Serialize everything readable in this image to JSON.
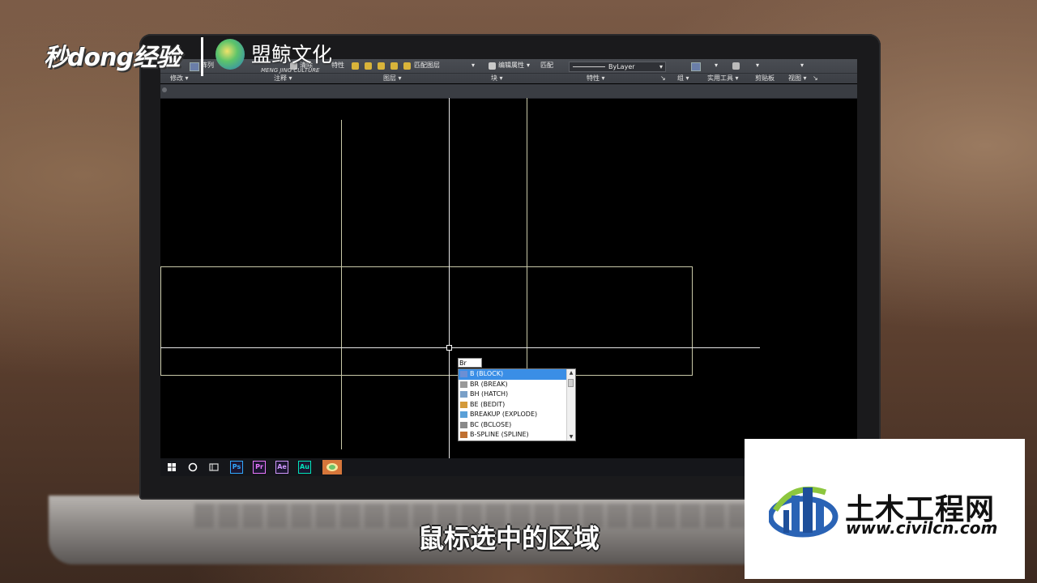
{
  "ribbon": {
    "row1": {
      "array_label": "阵列",
      "clear_label": "清除",
      "properties_label": "特性",
      "match_layer_label": "匹配图层",
      "edit_attr_label": "编辑属性",
      "match_label": "匹配",
      "bylayer_value": "ByLayer"
    },
    "panels": {
      "modify": "修改",
      "annotate": "注释",
      "layers": "图层",
      "block": "块",
      "properties": "特性",
      "group": "组",
      "utilities": "实用工具",
      "clipboard": "剪贴板",
      "view": "视图"
    }
  },
  "command": {
    "input_value": "Br",
    "suggestions": [
      {
        "label": "B (BLOCK)",
        "icon": "block-icon",
        "selected": true
      },
      {
        "label": "BR (BREAK)",
        "icon": "break-icon",
        "selected": false
      },
      {
        "label": "BH (HATCH)",
        "icon": "hatch-icon",
        "selected": false
      },
      {
        "label": "BE (BEDIT)",
        "icon": "bedit-icon",
        "selected": false
      },
      {
        "label": "BREAKUP (EXPLODE)",
        "icon": "explode-icon",
        "selected": false
      },
      {
        "label": "BC (BCLOSE)",
        "icon": "bclose-icon",
        "selected": false
      },
      {
        "label": "B-SPLINE (SPLINE)",
        "icon": "spline-icon",
        "selected": false
      }
    ]
  },
  "taskbar": {
    "apps": [
      {
        "name": "windows-start-icon",
        "label": ""
      },
      {
        "name": "cortana-search-icon",
        "label": ""
      },
      {
        "name": "task-view-icon",
        "label": ""
      },
      {
        "name": "photoshop-icon",
        "label": "Ps",
        "color": "#31a8ff"
      },
      {
        "name": "premiere-icon",
        "label": "Pr",
        "color": "#ea77ff"
      },
      {
        "name": "after-effects-icon",
        "label": "Ae",
        "color": "#cf96fd"
      },
      {
        "name": "audition-icon",
        "label": "Au",
        "color": "#00e4bb"
      },
      {
        "name": "autocad-icon",
        "label": "",
        "color": "#d6763a"
      }
    ]
  },
  "watermark": {
    "logo_text": "秒dong经验",
    "brand_text": "盟鲸文化",
    "brand_sub": "MENG JING CULTURE"
  },
  "subtitle": "鼠标选中的区域",
  "civil": {
    "title": "土木工程网",
    "url": "www.civilcn.com"
  },
  "colors": {
    "crosshair": "#e6e6e6",
    "rect_lines": "#c8c8a8",
    "selected_bg": "#3a8ee6"
  }
}
